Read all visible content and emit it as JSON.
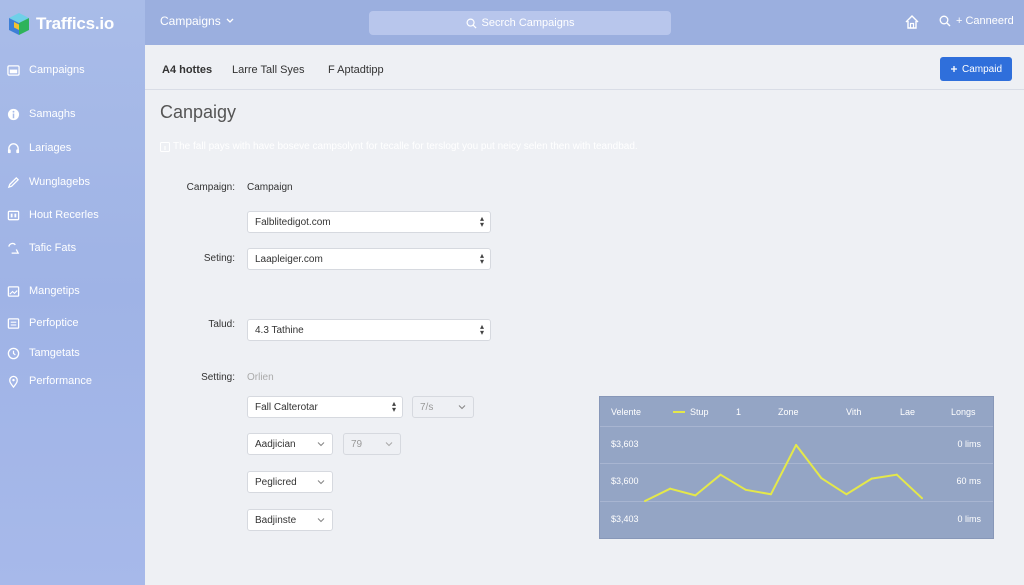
{
  "app": {
    "name": "Traffics.io"
  },
  "colors": {
    "sidebar": "#a9bce8",
    "topbar": "#9bafdf",
    "primary": "#2f6fdb",
    "chart_bg": "#94a5c5",
    "chart_line": "#e4e84a"
  },
  "sidebar": {
    "items": [
      {
        "label": "Campaigns",
        "icon": "dashboard-icon"
      },
      {
        "label": "Samaghs",
        "icon": "info-icon"
      },
      {
        "label": "Lariages",
        "icon": "headphones-icon"
      },
      {
        "label": "Wunglagebs",
        "icon": "pen-icon"
      },
      {
        "label": "Hout Recerles",
        "icon": "server-icon"
      },
      {
        "label": "Tafic Fats",
        "icon": "traffic-icon"
      },
      {
        "label": "Mangetips",
        "icon": "image-icon"
      },
      {
        "label": "Perfoptice",
        "icon": "list-icon"
      },
      {
        "label": "Tamgetats",
        "icon": "clock-icon"
      },
      {
        "label": "Performance",
        "icon": "location-icon"
      }
    ]
  },
  "topbar": {
    "menu_label": "Campaigns",
    "search_placeholder": "Secrch Campaigns",
    "user_label": "+ Canneerd"
  },
  "tabs": [
    {
      "label": "A4 hottes"
    },
    {
      "label": "Larre Tall Syes"
    },
    {
      "label": "F Aptadtipp"
    }
  ],
  "primary_button": {
    "label": "Campaid"
  },
  "page": {
    "title": "Canpaigy",
    "hint": "The fall pays with have boseve campsolynt for tecalle for terslogt you put neicy selen then with teandbad."
  },
  "form": {
    "campaign_label": "Campaign:",
    "campaign_value": "Campaign",
    "select1": "Falblitedigot.com",
    "setting_label": "Seting:",
    "select2": "Laapleiger.com",
    "talud_label": "Talud:",
    "select3": "4.3 Tathine",
    "setting2_label": "Setting:",
    "setting2_value": "Orlien",
    "select4": "Fall Calterotar",
    "select4b": "7/s",
    "select5": "Aadjician",
    "select5b": "79",
    "select6": "Peglicred",
    "select7": "Badjinste"
  },
  "chart_data": {
    "type": "line",
    "header": [
      "Velente",
      "Stup",
      "1",
      "Zone",
      "Vith",
      "Lae",
      "Longs"
    ],
    "y_labels": [
      "$3,603",
      "$3,600",
      "$3,403"
    ],
    "right_labels": [
      "0 lims",
      "60 ms",
      "0 lims"
    ],
    "series": [
      {
        "name": "Stup",
        "values": [
          0,
          0.22,
          0.1,
          0.47,
          0.2,
          0.12,
          1.0,
          0.41,
          0.12,
          0.4,
          0.47,
          0.05
        ]
      }
    ],
    "ylim": [
      0,
      1
    ]
  }
}
